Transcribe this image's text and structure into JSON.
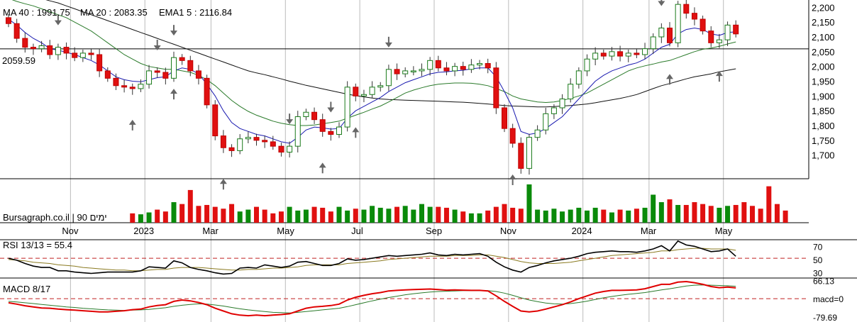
{
  "chart_data": {
    "type": "candlestick",
    "header": {
      "ma40_label": "MA 40 : 1991.75",
      "ma20_label": "MA 20 : 2083.35",
      "ema_label": "EMA1 5 : 2116.84"
    },
    "ref_level": {
      "value": 2059.59,
      "label": "2059.59"
    },
    "price_ticks": [
      "2,200",
      "2,150",
      "2,100",
      "2,050",
      "2,000",
      "1,950",
      "1,900",
      "1,850",
      "1,800",
      "1,750",
      "1,700"
    ],
    "price_tick_values": [
      2200,
      2150,
      2100,
      2050,
      2000,
      1950,
      1900,
      1850,
      1800,
      1750,
      1700
    ],
    "ylim": [
      1620,
      2220
    ],
    "month_labels": [
      {
        "label": "Nov",
        "week": 8
      },
      {
        "label": "2023",
        "week": 17
      },
      {
        "label": "Mar",
        "week": 25
      },
      {
        "label": "May",
        "week": 34
      },
      {
        "label": "Jul",
        "week": 43
      },
      {
        "label": "Sep",
        "week": 52
      },
      {
        "label": "Nov",
        "week": 61
      },
      {
        "label": "2024",
        "week": 70
      },
      {
        "label": "Mar",
        "week": 78
      },
      {
        "label": "May",
        "week": 87
      }
    ],
    "closes": [
      2145,
      2095,
      2065,
      2060,
      2070,
      2040,
      2065,
      2045,
      2030,
      2045,
      2040,
      1985,
      1960,
      1935,
      1930,
      1925,
      1940,
      1985,
      1980,
      1960,
      2030,
      2020,
      1985,
      1960,
      1870,
      1765,
      1725,
      1715,
      1755,
      1760,
      1750,
      1745,
      1730,
      1710,
      1730,
      1830,
      1845,
      1820,
      1780,
      1770,
      1795,
      1930,
      1900,
      1905,
      1930,
      1935,
      1990,
      1975,
      1985,
      1985,
      1990,
      2020,
      1995,
      1985,
      2000,
      1990,
      2005,
      2010,
      1995,
      1860,
      1790,
      1740,
      1655,
      1760,
      1785,
      1840,
      1860,
      1890,
      1940,
      1985,
      2025,
      2045,
      2035,
      2050,
      2035,
      2045,
      2040,
      2060,
      2100,
      2130,
      2080,
      2210,
      2180,
      2160,
      2120,
      2080,
      2090,
      2140,
      2110
    ],
    "ma_fast_ema": [
      2160,
      2140,
      2115,
      2095,
      2080,
      2060,
      2055,
      2048,
      2040,
      2030,
      2020,
      2005,
      1985,
      1965,
      1955,
      1950,
      1948,
      1955,
      1962,
      1965,
      1985,
      1995,
      1990,
      1975,
      1940,
      1900,
      1850,
      1810,
      1790,
      1780,
      1770,
      1765,
      1755,
      1745,
      1740,
      1760,
      1785,
      1795,
      1792,
      1788,
      1790,
      1825,
      1850,
      1865,
      1880,
      1895,
      1915,
      1930,
      1945,
      1955,
      1965,
      1975,
      1980,
      1982,
      1985,
      1987,
      1992,
      1995,
      1995,
      1965,
      1915,
      1860,
      1780,
      1770,
      1775,
      1790,
      1810,
      1830,
      1860,
      1890,
      1920,
      1950,
      1970,
      1985,
      1995,
      2005,
      2012,
      2025,
      2045,
      2065,
      2075,
      2110,
      2125,
      2130,
      2125,
      2110,
      2105,
      2115,
      2117
    ],
    "ma20": [
      2230,
      2220,
      2212,
      2205,
      2195,
      2185,
      2175,
      2165,
      2150,
      2135,
      2120,
      2100,
      2080,
      2060,
      2040,
      2025,
      2010,
      2000,
      1995,
      1990,
      1990,
      1985,
      1980,
      1970,
      1955,
      1935,
      1910,
      1885,
      1865,
      1848,
      1835,
      1825,
      1815,
      1808,
      1803,
      1800,
      1800,
      1802,
      1806,
      1810,
      1815,
      1825,
      1835,
      1845,
      1856,
      1866,
      1880,
      1895,
      1910,
      1920,
      1928,
      1935,
      1940,
      1942,
      1944,
      1944,
      1943,
      1940,
      1935,
      1925,
      1915,
      1900,
      1890,
      1885,
      1880,
      1878,
      1880,
      1885,
      1892,
      1900,
      1910,
      1925,
      1940,
      1955,
      1970,
      1985,
      1995,
      2002,
      2008,
      2015,
      2020,
      2030,
      2040,
      2050,
      2058,
      2062,
      2068,
      2076,
      2083
    ],
    "ma40": [
      2275,
      2262,
      2250,
      2240,
      2230,
      2222,
      2215,
      2205,
      2195,
      2185,
      2175,
      2165,
      2155,
      2145,
      2135,
      2125,
      2115,
      2105,
      2095,
      2085,
      2075,
      2065,
      2055,
      2045,
      2035,
      2025,
      2015,
      2005,
      1995,
      1985,
      1978,
      1972,
      1965,
      1958,
      1950,
      1943,
      1936,
      1930,
      1924,
      1918,
      1912,
      1906,
      1901,
      1897,
      1893,
      1890,
      1888,
      1887,
      1886,
      1885,
      1884,
      1883,
      1882,
      1881,
      1880,
      1879,
      1877,
      1875,
      1873,
      1870,
      1868,
      1866,
      1865,
      1864,
      1863,
      1863,
      1864,
      1866,
      1868,
      1870,
      1873,
      1877,
      1882,
      1887,
      1892,
      1898,
      1905,
      1915,
      1925,
      1935,
      1942,
      1950,
      1958,
      1965,
      1970,
      1975,
      1982,
      1987,
      1992
    ],
    "volumes": [
      0,
      0,
      0,
      0,
      0,
      0,
      0,
      0,
      0,
      0,
      0,
      0,
      0,
      0,
      0,
      1.0,
      0.9,
      1.1,
      1.4,
      1.2,
      2.2,
      2.0,
      3.5,
      1.8,
      1.9,
      1.7,
      1.5,
      2.0,
      1.2,
      1.4,
      1.7,
      1.4,
      1.0,
      1.2,
      1.7,
      1.3,
      1.4,
      1.7,
      1.6,
      1.2,
      1.7,
      1.3,
      1.5,
      1.4,
      1.8,
      1.6,
      1.5,
      1.7,
      1.8,
      1.4,
      2.0,
      1.7,
      1.7,
      1.6,
      1.4,
      1.2,
      1.0,
      1.0,
      1.3,
      1.7,
      2.0,
      1.6,
      1.5,
      4.1,
      1.4,
      1.3,
      1.5,
      1.2,
      1.4,
      1.6,
      1.3,
      1.6,
      1.4,
      1.1,
      1.4,
      1.3,
      1.5,
      1.6,
      3.0,
      2.2,
      2.5,
      1.9,
      1.9,
      2.2,
      2.0,
      1.8,
      1.6,
      1.8,
      1.9,
      2.2,
      1.8,
      1.5,
      3.9,
      2.0,
      1.3
    ],
    "up_down": "mixed",
    "rsi": {
      "label": "RSI 13/13 = 55.4",
      "ticks": [
        "70",
        "50",
        "30"
      ],
      "tick_values": [
        70,
        50,
        30
      ],
      "ylim": [
        22,
        80
      ],
      "ref_value": 52,
      "values": [
        52,
        49,
        44,
        40,
        38,
        38,
        33,
        33,
        31,
        30,
        29,
        30,
        31,
        31,
        31,
        31,
        33,
        39,
        38,
        37,
        48,
        45,
        38,
        35,
        33,
        30,
        28,
        29,
        37,
        38,
        37,
        42,
        40,
        38,
        40,
        46,
        47,
        44,
        41,
        41,
        44,
        51,
        49,
        50,
        52,
        54,
        56,
        55,
        56,
        57,
        58,
        60,
        57,
        56,
        58,
        57,
        58,
        59,
        55,
        46,
        39,
        34,
        31,
        38,
        41,
        45,
        48,
        50,
        52,
        55,
        59,
        61,
        62,
        63,
        62,
        62,
        61,
        63,
        66,
        71,
        63,
        78,
        72,
        70,
        66,
        62,
        63,
        66,
        55
      ],
      "signal": [
        50,
        49,
        48,
        46,
        45,
        44,
        42,
        41,
        40,
        38,
        37,
        36,
        35,
        34,
        34,
        33,
        33,
        34,
        35,
        35,
        37,
        38,
        38,
        38,
        37,
        36,
        35,
        34,
        34,
        35,
        35,
        36,
        37,
        37,
        38,
        39,
        41,
        42,
        42,
        42,
        42,
        44,
        45,
        46,
        47,
        48,
        50,
        51,
        52,
        53,
        54,
        55,
        55,
        55,
        56,
        56,
        56,
        57,
        57,
        55,
        53,
        50,
        47,
        45,
        44,
        44,
        44,
        45,
        46,
        48,
        50,
        52,
        54,
        56,
        57,
        58,
        59,
        60,
        61,
        63,
        63,
        65,
        66,
        67,
        67,
        66,
        66,
        66,
        64
      ]
    },
    "macd": {
      "label": "MACD 8/17",
      "ticks": [
        "66.13",
        "macd=0",
        "-79.69"
      ],
      "tick_values": [
        66.13,
        0,
        -79.69
      ],
      "ylim": [
        -85,
        75
      ],
      "values": [
        -15,
        -20,
        -26,
        -30,
        -34,
        -35,
        -38,
        -40,
        -42,
        -44,
        -46,
        -48,
        -48,
        -46,
        -44,
        -40,
        -38,
        -30,
        -25,
        -22,
        -10,
        -5,
        -8,
        -14,
        -22,
        -35,
        -45,
        -55,
        -60,
        -62,
        -60,
        -62,
        -60,
        -58,
        -55,
        -45,
        -35,
        -30,
        -28,
        -25,
        -20,
        -5,
        5,
        12,
        18,
        22,
        28,
        30,
        32,
        33,
        34,
        35,
        33,
        31,
        32,
        31,
        30,
        30,
        28,
        10,
        -10,
        -28,
        -45,
        -48,
        -45,
        -38,
        -30,
        -22,
        -12,
        0,
        10,
        20,
        26,
        30,
        30,
        31,
        32,
        36,
        44,
        52,
        52,
        60,
        62,
        58,
        52,
        44,
        40,
        42,
        39
      ],
      "signal": [
        -10,
        -12,
        -15,
        -18,
        -21,
        -24,
        -27,
        -30,
        -32,
        -35,
        -37,
        -39,
        -41,
        -42,
        -43,
        -42,
        -41,
        -39,
        -36,
        -33,
        -28,
        -24,
        -21,
        -19,
        -20,
        -23,
        -27,
        -32,
        -37,
        -41,
        -44,
        -47,
        -50,
        -51,
        -52,
        -50,
        -47,
        -44,
        -41,
        -38,
        -35,
        -29,
        -22,
        -15,
        -8,
        -2,
        4,
        9,
        14,
        18,
        21,
        24,
        26,
        27,
        28,
        29,
        29,
        29,
        29,
        26,
        20,
        12,
        3,
        -5,
        -11,
        -16,
        -19,
        -20,
        -18,
        -14,
        -9,
        -3,
        3,
        8,
        12,
        16,
        19,
        22,
        27,
        32,
        36,
        41,
        46,
        49,
        50,
        49,
        48,
        47,
        45
      ]
    },
    "watermark": "Bursagraph.co.il | 90 ימים"
  }
}
